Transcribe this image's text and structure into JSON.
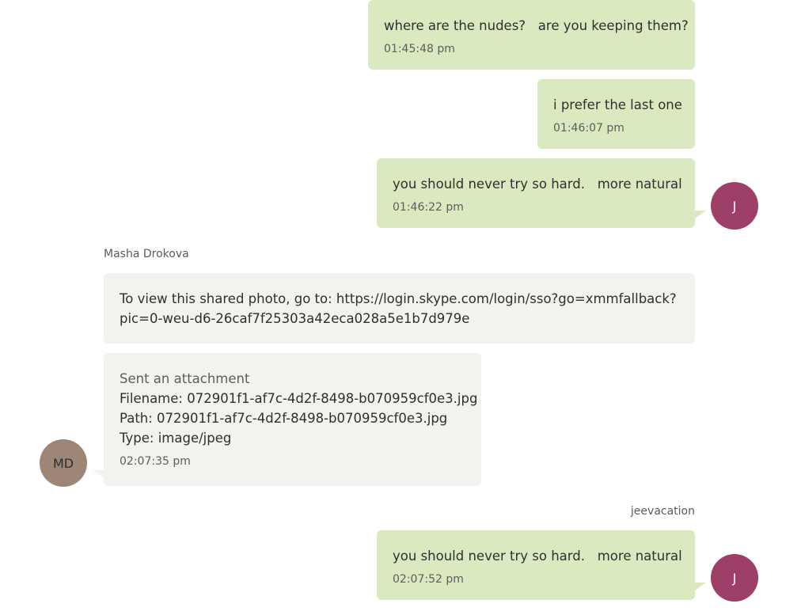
{
  "messages": [
    {
      "text": "where are the nudes?   are you keeping them?",
      "time": "01:45:48 pm"
    },
    {
      "text": "i prefer the last one",
      "time": "01:46:07 pm"
    },
    {
      "text": "you should never try so hard.   more natural",
      "time": "01:46:22 pm",
      "avatar": "J"
    },
    {
      "sender": "Masha Drokova",
      "lines": [
        "To view this shared photo, go to: https://login.skype.com/login/sso?go=xmmfallback?",
        "pic=0-weu-d6-26caf7f25303a42eca028a5e1b7d979e"
      ]
    },
    {
      "title": "Sent an attachment",
      "lines": [
        "Filename: 072901f1-af7c-4d2f-8498-b070959cf0e3.jpg",
        "Path: 072901f1-af7c-4d2f-8498-b070959cf0e3.jpg",
        "Type: image/jpeg"
      ],
      "time": "02:07:35 pm",
      "avatar": "MD"
    },
    {
      "sender": "jeevacation",
      "text": "you should never try so hard.   more natural",
      "time": "02:07:52 pm",
      "avatar": "J"
    }
  ],
  "colors": {
    "outgoing": "#dbe9c0",
    "incoming": "#f3f2ee",
    "avatar_j": "#9d3f66",
    "avatar_md": "#9e8677"
  }
}
